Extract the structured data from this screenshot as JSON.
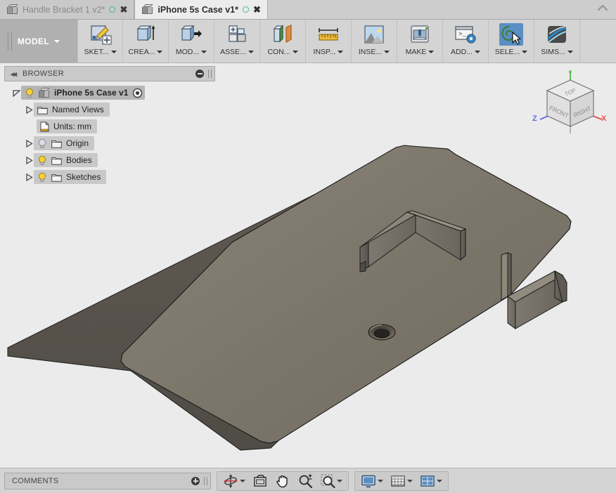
{
  "window": {
    "collapse_icon": "chevron-up-icon"
  },
  "tabs": [
    {
      "label": "Handle Bracket 1 v2*",
      "active": false,
      "doc_icon": "cube-icon",
      "status_icon": "sync-circle-icon",
      "close_icon": "close-icon"
    },
    {
      "label": "iPhone 5s Case v1*",
      "active": true,
      "doc_icon": "cube-icon",
      "status_icon": "sync-circle-icon",
      "close_icon": "close-icon"
    }
  ],
  "ribbon": {
    "workspace": {
      "label": "MODEL",
      "caret": "caret-down-icon",
      "grip": "drag-grip-icon"
    },
    "items": [
      {
        "label": "SKET...",
        "full": "SKETCH",
        "icon": "sketch-icon",
        "caret": "caret-down-icon",
        "selected": false
      },
      {
        "label": "CREA...",
        "full": "CREATE",
        "icon": "create-extrude-icon",
        "caret": "caret-down-icon",
        "selected": false
      },
      {
        "label": "MOD...",
        "full": "MODIFY",
        "icon": "modify-icon",
        "caret": "caret-down-icon",
        "selected": false
      },
      {
        "label": "ASSE...",
        "full": "ASSEMBLE",
        "icon": "assemble-icon",
        "caret": "caret-down-icon",
        "selected": false
      },
      {
        "label": "CON...",
        "full": "CONSTRUCT",
        "icon": "construct-plane-icon",
        "caret": "caret-down-icon",
        "selected": false
      },
      {
        "label": "INSP...",
        "full": "INSPECT",
        "icon": "ruler-measure-icon",
        "caret": "caret-down-icon",
        "selected": false
      },
      {
        "label": "INSE...",
        "full": "INSERT",
        "icon": "insert-image-icon",
        "caret": "caret-down-icon",
        "selected": false
      },
      {
        "label": "MAKE",
        "full": "MAKE",
        "icon": "3d-print-icon",
        "caret": "caret-down-icon",
        "selected": false
      },
      {
        "label": "ADD...",
        "full": "ADD-INS",
        "icon": "script-addin-icon",
        "caret": "caret-down-icon",
        "selected": false
      },
      {
        "label": "SELE...",
        "full": "SELECT",
        "icon": "lasso-select-icon",
        "caret": "caret-down-icon",
        "selected": true
      },
      {
        "label": "SIMS...",
        "full": "SIM",
        "icon": "simulation-icon",
        "caret": "caret-down-icon",
        "selected": false
      }
    ]
  },
  "browser": {
    "title": "BROWSER",
    "collapse_icon": "double-arrow-left-icon",
    "minimize_icon": "minus-circle-icon",
    "grip_icon": "drag-grip-icon",
    "tree": [
      {
        "label": "iPhone 5s Case v1",
        "level": 0,
        "expander": "expanded",
        "bulb": "on",
        "node_icon": "component-cube-icon",
        "trailing_icon": "activate-target-icon",
        "selected": true
      },
      {
        "label": "Named Views",
        "level": 1,
        "expander": "collapsed",
        "bulb": "none",
        "node_icon": "folder-icon",
        "trailing_icon": "",
        "selected": false
      },
      {
        "label": "Units: mm",
        "level": 2,
        "expander": "none",
        "bulb": "none",
        "node_icon": "units-doc-icon",
        "trailing_icon": "",
        "selected": false
      },
      {
        "label": "Origin",
        "level": 1,
        "expander": "collapsed",
        "bulb": "off",
        "node_icon": "folder-icon",
        "trailing_icon": "",
        "selected": false
      },
      {
        "label": "Bodies",
        "level": 1,
        "expander": "collapsed",
        "bulb": "on",
        "node_icon": "folder-icon",
        "trailing_icon": "",
        "selected": false
      },
      {
        "label": "Sketches",
        "level": 1,
        "expander": "collapsed",
        "bulb": "on",
        "node_icon": "folder-icon",
        "trailing_icon": "",
        "selected": false
      }
    ]
  },
  "viewcube": {
    "faces": {
      "top": "TOP",
      "front": "FRONT",
      "right": "RIGHT"
    },
    "axes": [
      {
        "label": "X",
        "color": "#e0554e"
      },
      {
        "label": "Y",
        "color": "#5dbb55"
      },
      {
        "label": "Z",
        "color": "#5f6fe0"
      }
    ]
  },
  "canvas": {
    "background": "#ebebeb",
    "model_name": "iPhone 5s Case",
    "body_color": "#7a7468",
    "edge_color": "#1b1b1b",
    "features": [
      "base-plate",
      "rounded-corners",
      "countersunk-hole",
      "corner-lip-wall-left",
      "corner-lip-wall-right"
    ]
  },
  "bottombar": {
    "comments": {
      "title": "COMMENTS",
      "add_icon": "plus-circle-icon",
      "grip_icon": "drag-grip-icon"
    },
    "nav_group_1": [
      {
        "name": "orbit",
        "icon": "orbit-icon",
        "caret": true
      },
      {
        "name": "look-at",
        "icon": "look-at-camera-icon",
        "caret": false
      },
      {
        "name": "pan",
        "icon": "pan-hand-icon",
        "caret": false
      },
      {
        "name": "zoom",
        "icon": "zoom-magnifier-icon",
        "caret": false
      },
      {
        "name": "zoom-window",
        "icon": "zoom-window-icon",
        "caret": true
      }
    ],
    "nav_group_2": [
      {
        "name": "display-settings",
        "icon": "display-monitor-icon",
        "caret": true
      },
      {
        "name": "grid-and-snaps",
        "icon": "grid-icon",
        "caret": true
      },
      {
        "name": "viewport-layout",
        "icon": "viewport-layout-icon",
        "caret": true
      }
    ]
  },
  "colors": {
    "accent_blue": "#5a8fc4",
    "panel_gray": "#d4d4d4",
    "tab_active": "#ececec",
    "tab_inactive": "#c9c9c9",
    "canvas_bg": "#ebebeb",
    "model_body": "#7a7468"
  }
}
